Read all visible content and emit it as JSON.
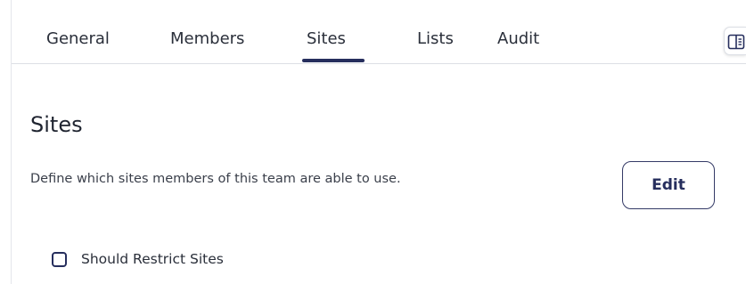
{
  "tabs": {
    "items": [
      {
        "label": "General"
      },
      {
        "label": "Members"
      },
      {
        "label": "Sites"
      },
      {
        "label": "Lists"
      },
      {
        "label": "Audit"
      }
    ],
    "active": "Sites"
  },
  "side_toggle": {
    "icon": "panel-toggle-icon"
  },
  "section": {
    "title": "Sites",
    "description": "Define which sites members of this team are able to use.",
    "edit_label": "Edit"
  },
  "restrict": {
    "label": "Should Restrict Sites",
    "checked": false
  },
  "colors": {
    "accent": "#262e5d",
    "divider": "#dcdfe5",
    "text": "#1f2430"
  }
}
